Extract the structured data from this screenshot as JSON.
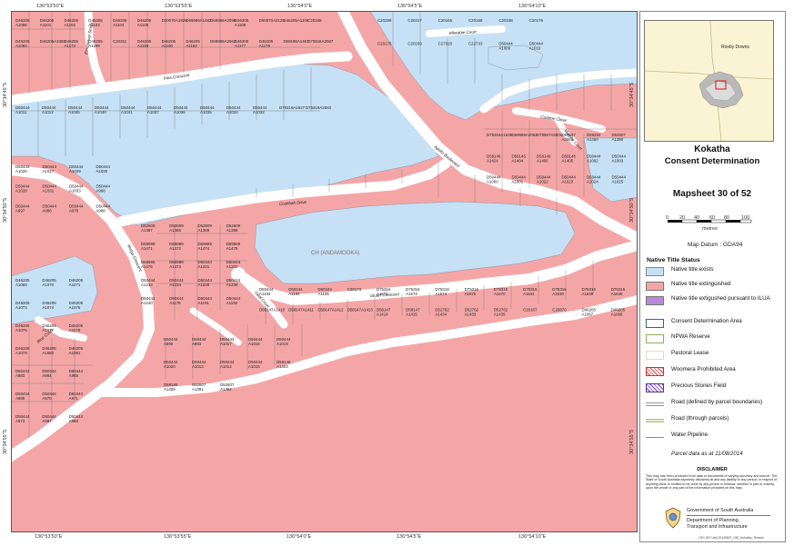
{
  "map": {
    "title_line1": "Kokatha",
    "title_line2": "Consent Determination",
    "mapsheet": "Mapsheet 30 of 52",
    "scale_ticks": [
      "0",
      "20",
      "40",
      "60",
      "80",
      "100"
    ],
    "scale_unit": "metres",
    "datum": "Map Datum : GDA94",
    "inset_town": "Roxby Downs",
    "parcel_date": "Parcel data as at 11/08/2014",
    "disclaimer_title": "DISCLAIMER",
    "disclaimer_text": "This map has been produced from data or documents of varying accuracy and source. The State of South Australia expressly disclaims all and any liability to any person, in respect of anything done or omitted to be done by any person in reliance, whether in part or entirely, upon the whole or any part of the information provided on this map.",
    "gov_line1": "Government of South Australia",
    "gov_line2": "Department of Planning,",
    "gov_line3": "Transport and Infrastructure",
    "footer_ref": "LSG GIS Unit 20140807_030_Kokatha_Terrace"
  },
  "colors": {
    "native_title_exists": "#c6e1f5",
    "native_title_extinguished": "#f4a6a6",
    "ilua": "#b889d8",
    "road": "#ffffff",
    "parcel_edge": "#555555"
  },
  "axes": {
    "top": [
      "136°53'50\"E",
      "136°53'55\"E",
      "136°54'0\"E",
      "136°54'5\"E",
      "136°54'10\"E"
    ],
    "bottom": [
      "136°53'50\"E",
      "136°53'55\"E",
      "136°54'0\"E",
      "136°54'5\"E",
      "136°54'10\"E"
    ],
    "left": [
      "30°34'45\"S",
      "30°34'50\"S",
      "30°34'55\"S"
    ],
    "right": [
      "30°34'45\"S",
      "30°34'50\"S",
      "30°34'55\"S"
    ]
  },
  "legend": {
    "header": "Native Title Status",
    "items": [
      {
        "label": "Native title exists",
        "kind": "fill-blue"
      },
      {
        "label": "Native title extinguished",
        "kind": "fill-red"
      },
      {
        "label": "Native title extigushed pursuant to ILUA",
        "kind": "fill-purple"
      },
      {
        "label": "Consent Determination Area",
        "kind": "outline-teal"
      },
      {
        "label": "NPWA Reserve",
        "kind": "outline-green"
      },
      {
        "label": "Pastoral Lease",
        "kind": "outline-tan"
      },
      {
        "label": "Woomera Prohibited Area",
        "kind": "hatch-red"
      },
      {
        "label": "Precious Stones Field",
        "kind": "hatch-purple"
      },
      {
        "label": "Road (defined by parcel boundaries)",
        "kind": "road-grey"
      },
      {
        "label": "Road (through parcels)",
        "kind": "road-olive"
      },
      {
        "label": "Water Pipeline",
        "kind": "line-blue"
      }
    ]
  },
  "roads": [
    {
      "name": "Pine Crescent"
    },
    {
      "name": "Coolibah Drive"
    },
    {
      "name": "Apollo Boulevard"
    },
    {
      "name": "Stuart Crescent"
    },
    {
      "name": "Mulga Crescent"
    },
    {
      "name": "Emmanuel Street"
    },
    {
      "name": "Mintabie Court"
    },
    {
      "name": "Carbine Close"
    },
    {
      "name": "Morphe Court"
    },
    {
      "name": "Opal Court"
    },
    {
      "name": "Blue Court"
    }
  ],
  "park": {
    "label": "CH (ANDAMOOKA)"
  },
  "parcels": [
    {
      "id": "D46205 A1086"
    },
    {
      "id": "D46205 A1101"
    },
    {
      "id": "D46205 A1102"
    },
    {
      "id": "D46205 A1103"
    },
    {
      "id": "D46205 A1104"
    },
    {
      "id": "D46205 A1105"
    },
    {
      "id": "D20070A1826"
    },
    {
      "id": "D69986A1482"
    },
    {
      "id": "D69986A2099"
    },
    {
      "id": "D46205 A1108"
    },
    {
      "id": "D60070A2125"
    },
    {
      "id": "D46205A1109"
    },
    {
      "id": "C20348"
    },
    {
      "id": "D46205 A1084"
    },
    {
      "id": "D46205A1083"
    },
    {
      "id": "D46205 A1173"
    },
    {
      "id": "D46205 A1199"
    },
    {
      "id": "C20311"
    },
    {
      "id": "D46205 A1159"
    },
    {
      "id": "D46205 A1160"
    },
    {
      "id": "D46205 A1163"
    },
    {
      "id": "D69986A2062"
    },
    {
      "id": "D46205 A1177"
    },
    {
      "id": "D46205 A1178"
    },
    {
      "id": "D59186A1467"
    },
    {
      "id": "D70916A2087"
    },
    {
      "id": "C20298"
    },
    {
      "id": "C20317"
    },
    {
      "id": "C20166"
    },
    {
      "id": "C20168"
    },
    {
      "id": "C20338"
    },
    {
      "id": "C20176"
    },
    {
      "id": "C20175"
    },
    {
      "id": "C20169"
    },
    {
      "id": "C27020"
    },
    {
      "id": "C22733"
    },
    {
      "id": "D50444 A1009"
    },
    {
      "id": "D50444 A1010"
    },
    {
      "id": "D50444 A1011"
    },
    {
      "id": "D50444 A1012"
    },
    {
      "id": "D50444 A1045"
    },
    {
      "id": "D50444 A1040"
    },
    {
      "id": "D50444 A1041"
    },
    {
      "id": "D50444 A1037"
    },
    {
      "id": "D50444 A1036"
    },
    {
      "id": "D50444 A1035"
    },
    {
      "id": "D50444 A1034"
    },
    {
      "id": "D50444 A1032"
    },
    {
      "id": "D75316A1627"
    },
    {
      "id": "D75316A2083"
    },
    {
      "id": "D75316A1636"
    },
    {
      "id": "D69986A2063"
    },
    {
      "id": "D79957A3001"
    },
    {
      "id": "D69687 A2061"
    },
    {
      "id": "D59292 A1450"
    },
    {
      "id": "D52607 A1390"
    },
    {
      "id": "D58146 A1424"
    },
    {
      "id": "D58146 A1404"
    },
    {
      "id": "D58146 A1406"
    },
    {
      "id": "D58146 A1405"
    },
    {
      "id": "D50444 A1002"
    },
    {
      "id": "D50444 A1003"
    },
    {
      "id": "D50444 A1000"
    },
    {
      "id": "D50444 A1001"
    },
    {
      "id": "D50444 A1022"
    },
    {
      "id": "D50444 A1023"
    },
    {
      "id": "D50444 A1024"
    },
    {
      "id": "D50444 A1025"
    },
    {
      "id": "D50444 A1026"
    },
    {
      "id": "D50444 A1027"
    },
    {
      "id": "D50444 A1029"
    },
    {
      "id": "D50444 A1030"
    },
    {
      "id": "D50444 A1028"
    },
    {
      "id": "D50444 A1031"
    },
    {
      "id": "D50444 A1033"
    },
    {
      "id": "D50444 A998"
    },
    {
      "id": "D50444 A997"
    },
    {
      "id": "D50444 A996"
    },
    {
      "id": "D50444 A978"
    },
    {
      "id": "D50444 A988"
    },
    {
      "id": "D52609 A1387"
    },
    {
      "id": "D52609 A1386"
    },
    {
      "id": "D52609 A1389"
    },
    {
      "id": "D52609 A1388"
    },
    {
      "id": "D69989 A1471"
    },
    {
      "id": "D69989 A1472"
    },
    {
      "id": "D69989 A1474"
    },
    {
      "id": "D69989 A1475"
    },
    {
      "id": "D69989 A1476"
    },
    {
      "id": "D69989 A1473"
    },
    {
      "id": "D50444 A1231"
    },
    {
      "id": "D50444 A1232"
    },
    {
      "id": "D50444 A1233"
    },
    {
      "id": "D50444 A1234"
    },
    {
      "id": "D50444 A1238"
    },
    {
      "id": "D50444 A1239"
    },
    {
      "id": "D50444 A1240"
    },
    {
      "id": "D50444 A1178"
    },
    {
      "id": "D50444 A1191"
    },
    {
      "id": "D50444 A1192"
    },
    {
      "id": "D50444 A1193"
    },
    {
      "id": "D50444 A1194"
    },
    {
      "id": "D50444 A1195"
    },
    {
      "id": "C20173"
    },
    {
      "id": "D75316 A1672"
    },
    {
      "id": "D75316 A1673"
    },
    {
      "id": "D75316 A1674"
    },
    {
      "id": "D75316 A1675"
    },
    {
      "id": "D75316 A1670"
    },
    {
      "id": "D75316 A1631"
    },
    {
      "id": "D75316 A1630"
    },
    {
      "id": "D75316 A1629"
    },
    {
      "id": "D75316 A1628"
    },
    {
      "id": "D58147A1410"
    },
    {
      "id": "D58147A1411"
    },
    {
      "id": "D58147A1412"
    },
    {
      "id": "D58147A1413"
    },
    {
      "id": "D58147 A1414"
    },
    {
      "id": "D58147 A1415"
    },
    {
      "id": "D52762 A1434"
    },
    {
      "id": "D52762 A1433"
    },
    {
      "id": "D52762 A1435"
    },
    {
      "id": "C20167"
    },
    {
      "id": "C20870"
    },
    {
      "id": "D46205 A1067"
    },
    {
      "id": "D46205 A1068"
    },
    {
      "id": "D46205 A1069"
    },
    {
      "id": "D46205 A1070"
    },
    {
      "id": "D46205 A1071"
    },
    {
      "id": "D46205 A1073"
    },
    {
      "id": "D46205 A1074"
    },
    {
      "id": "D46205 A1075"
    },
    {
      "id": "D46205 A1076"
    },
    {
      "id": "D46205 A1077"
    },
    {
      "id": "D46205 A1078"
    },
    {
      "id": "D46205 A1079"
    },
    {
      "id": "D46205 A1080"
    },
    {
      "id": "D46205 A1081"
    },
    {
      "id": "D50444 A983"
    },
    {
      "id": "D50444 A984"
    },
    {
      "id": "D50444 A985"
    },
    {
      "id": "D50444 A986"
    },
    {
      "id": "D50444 A970"
    },
    {
      "id": "D50444 A971"
    },
    {
      "id": "D50444 A973"
    },
    {
      "id": "D50444 A987"
    },
    {
      "id": "D50444 A989"
    },
    {
      "id": "D50444 A990"
    },
    {
      "id": "D50444 A993"
    },
    {
      "id": "D50444 A1017"
    },
    {
      "id": "D50444 A1018"
    },
    {
      "id": "D50444 A1019"
    },
    {
      "id": "D50444 A1020"
    },
    {
      "id": "D50444 A1013"
    },
    {
      "id": "D50444 A1014"
    },
    {
      "id": "D50444 A1015"
    },
    {
      "id": "D58146 A1403"
    },
    {
      "id": "D59186 A1459"
    },
    {
      "id": "D52607 A1391"
    },
    {
      "id": "D52607 A1392"
    }
  ]
}
